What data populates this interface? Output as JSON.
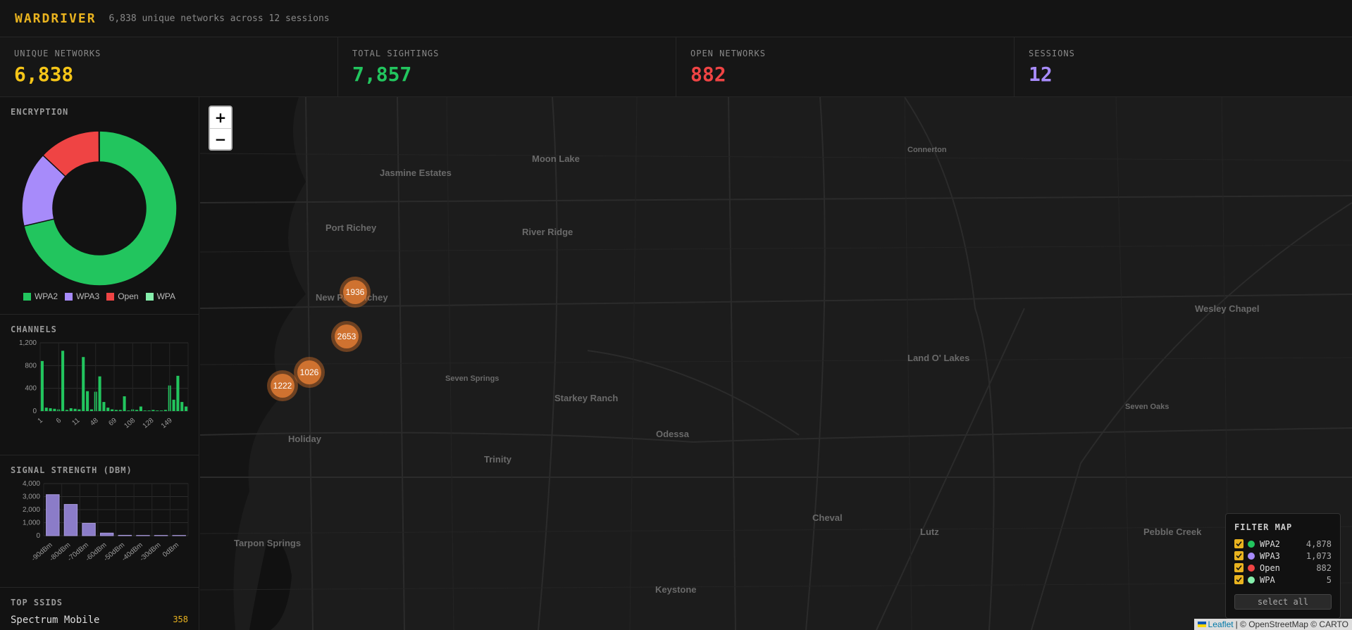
{
  "app": {
    "title": "WARDRIVER",
    "subtitle": "6,838 unique networks across 12 sessions"
  },
  "stats": [
    {
      "label": "UNIQUE NETWORKS",
      "value": "6,838",
      "color": "#f5c518"
    },
    {
      "label": "TOTAL SIGHTINGS",
      "value": "7,857",
      "color": "#22c55e"
    },
    {
      "label": "OPEN NETWORKS",
      "value": "882",
      "color": "#ef4444"
    },
    {
      "label": "SESSIONS",
      "value": "12",
      "color": "#a78bfa"
    }
  ],
  "encryption": {
    "title": "ENCRYPTION",
    "legend": [
      {
        "label": "WPA2",
        "color": "#22c55e"
      },
      {
        "label": "WPA3",
        "color": "#a78bfa"
      },
      {
        "label": "Open",
        "color": "#ef4444"
      },
      {
        "label": "WPA",
        "color": "#86efac"
      }
    ]
  },
  "channels": {
    "title": "CHANNELS"
  },
  "signal": {
    "title": "SIGNAL STRENGTH (DBM)"
  },
  "top_ssids": {
    "title": "TOP SSIDS",
    "items": [
      {
        "name": "Spectrum Mobile",
        "count": "358"
      }
    ]
  },
  "map": {
    "zoom_in": "+",
    "zoom_out": "−",
    "clusters": [
      "1936",
      "2653",
      "1026",
      "1222"
    ],
    "places": [
      "Moon Lake",
      "Jasmine Estates",
      "Connerton",
      "Port Richey",
      "River Ridge",
      "New Port Richey",
      "Wesley Chapel",
      "Land O' Lakes",
      "Seven Springs",
      "Starkey Ranch",
      "Seven Oaks",
      "Holiday",
      "Odessa",
      "Trinity",
      "Cheval",
      "Tarpon Springs",
      "Lutz",
      "Pebble Creek",
      "Keystone"
    ],
    "filter": {
      "title": "FILTER MAP",
      "items": [
        {
          "label": "WPA2",
          "count": "4,878",
          "color": "#22c55e"
        },
        {
          "label": "WPA3",
          "count": "1,073",
          "color": "#a78bfa"
        },
        {
          "label": "Open",
          "count": "882",
          "color": "#ef4444"
        },
        {
          "label": "WPA",
          "count": "5",
          "color": "#86efac"
        }
      ],
      "select_all": "select all"
    },
    "attribution": {
      "leaflet": "Leaflet",
      "rest": "| © OpenStreetMap © CARTO"
    }
  },
  "chart_data": [
    {
      "type": "pie",
      "title": "ENCRYPTION",
      "categories": [
        "WPA2",
        "WPA3",
        "Open",
        "WPA"
      ],
      "values": [
        4878,
        1073,
        882,
        5
      ],
      "colors": [
        "#22c55e",
        "#a78bfa",
        "#ef4444",
        "#86efac"
      ]
    },
    {
      "type": "bar",
      "title": "CHANNELS",
      "tick_labels": [
        "1",
        "6",
        "11",
        "48",
        "69",
        "108",
        "128",
        "149"
      ],
      "values": [
        880,
        60,
        50,
        40,
        30,
        1060,
        20,
        50,
        40,
        30,
        950,
        350,
        30,
        340,
        610,
        160,
        60,
        30,
        20,
        20,
        260,
        10,
        30,
        20,
        80,
        10,
        10,
        20,
        10,
        10,
        20,
        450,
        200,
        620,
        160,
        80
      ],
      "ylim": [
        0,
        1200
      ],
      "yticks": [
        "0",
        "400",
        "800",
        "1,200"
      ],
      "color": "#22c55e"
    },
    {
      "type": "bar",
      "title": "SIGNAL STRENGTH (DBM)",
      "categories": [
        "-90dBm",
        "-80dBm",
        "-70dBm",
        "-60dBm",
        "-50dBm",
        "-40dBm",
        "-30dBm",
        "0dBm"
      ],
      "values": [
        3150,
        2400,
        950,
        200,
        30,
        20,
        20,
        20
      ],
      "ylim": [
        0,
        4000
      ],
      "yticks": [
        "0",
        "1,000",
        "2,000",
        "3,000",
        "4,000"
      ],
      "color": "#8b7cc8"
    }
  ]
}
